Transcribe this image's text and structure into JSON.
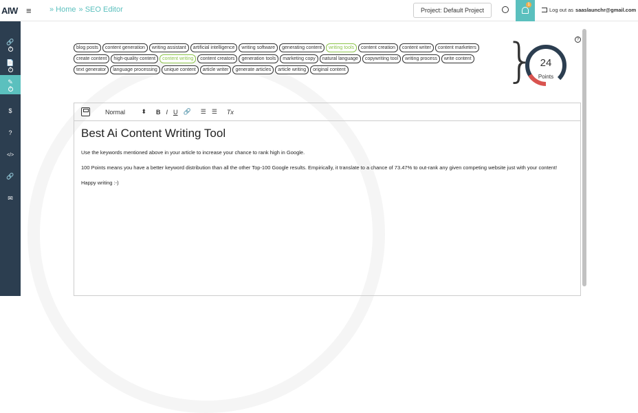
{
  "header": {
    "logo": "AIW",
    "menu_icon": "≡",
    "breadcrumb": [
      "» Home",
      "» SEO Editor"
    ],
    "project_label": "Project: Default Project",
    "notification_count": "1",
    "logout_prefix": "Log out as",
    "user_email": "saaslaunchr@gmail.com"
  },
  "sidebar": {
    "items": [
      {
        "icon": "🔗",
        "name": "link-tool"
      },
      {
        "icon": "📄",
        "name": "document"
      },
      {
        "icon": "✎",
        "name": "seo-editor"
      },
      {
        "icon": "$",
        "name": "pricing"
      },
      {
        "icon": "?",
        "name": "help"
      },
      {
        "icon": "</>",
        "name": "code"
      },
      {
        "icon": "🔗",
        "name": "links"
      },
      {
        "icon": "✉",
        "name": "mail"
      }
    ],
    "help_marker": "?"
  },
  "keywords": [
    {
      "text": "blog posts",
      "used": false
    },
    {
      "text": "content generation",
      "used": false
    },
    {
      "text": "writing assistant",
      "used": false
    },
    {
      "text": "artificial intelligence",
      "used": false
    },
    {
      "text": "writing software",
      "used": false
    },
    {
      "text": "generating content",
      "used": false
    },
    {
      "text": "writing tools",
      "used": true
    },
    {
      "text": "content creation",
      "used": false
    },
    {
      "text": "content writer",
      "used": false
    },
    {
      "text": "content marketers",
      "used": false
    },
    {
      "text": "create content",
      "used": false
    },
    {
      "text": "high-quality content",
      "used": false
    },
    {
      "text": "content writing",
      "used": true
    },
    {
      "text": "content creators",
      "used": false
    },
    {
      "text": "generation tools",
      "used": false
    },
    {
      "text": "marketing copy",
      "used": false
    },
    {
      "text": "natural language",
      "used": false
    },
    {
      "text": "copywriting tool",
      "used": false
    },
    {
      "text": "writing process",
      "used": false
    },
    {
      "text": "write content",
      "used": false
    },
    {
      "text": "text generator",
      "used": false
    },
    {
      "text": "language processing",
      "used": false
    },
    {
      "text": "unique content",
      "used": false
    },
    {
      "text": "article writer",
      "used": false
    },
    {
      "text": "generate articles",
      "used": false
    },
    {
      "text": "article writing",
      "used": false
    },
    {
      "text": "original content",
      "used": false
    }
  ],
  "score": {
    "value": "24",
    "label": "Points",
    "help": "?",
    "fraction": 0.24,
    "colors": {
      "track": "#2c3e50",
      "progress": "#d9534f"
    }
  },
  "toolbar": {
    "format_value": "Normal",
    "format_arrow": "⬍",
    "bold": "B",
    "italic": "I",
    "underline": "U",
    "link": "🔗",
    "ordered_list": "☰",
    "bullet_list": "☰",
    "clear_format": "Tx"
  },
  "document": {
    "title": "Best Ai Content Writing Tool",
    "paragraphs": [
      "Use the keywords mentioned above in your article to increase your chance to rank high in Google.",
      "100 Points means you have a better keyword distribution than all the other Top-100 Google results. Empirically, it translate to a chance of 73.47% to out-rank any given competing website just with your content!",
      "Happy writing :-)"
    ]
  },
  "colors": {
    "accent": "#5bc0be",
    "sidebar": "#2c3e50",
    "keyword_hit": "#8bc34a"
  }
}
